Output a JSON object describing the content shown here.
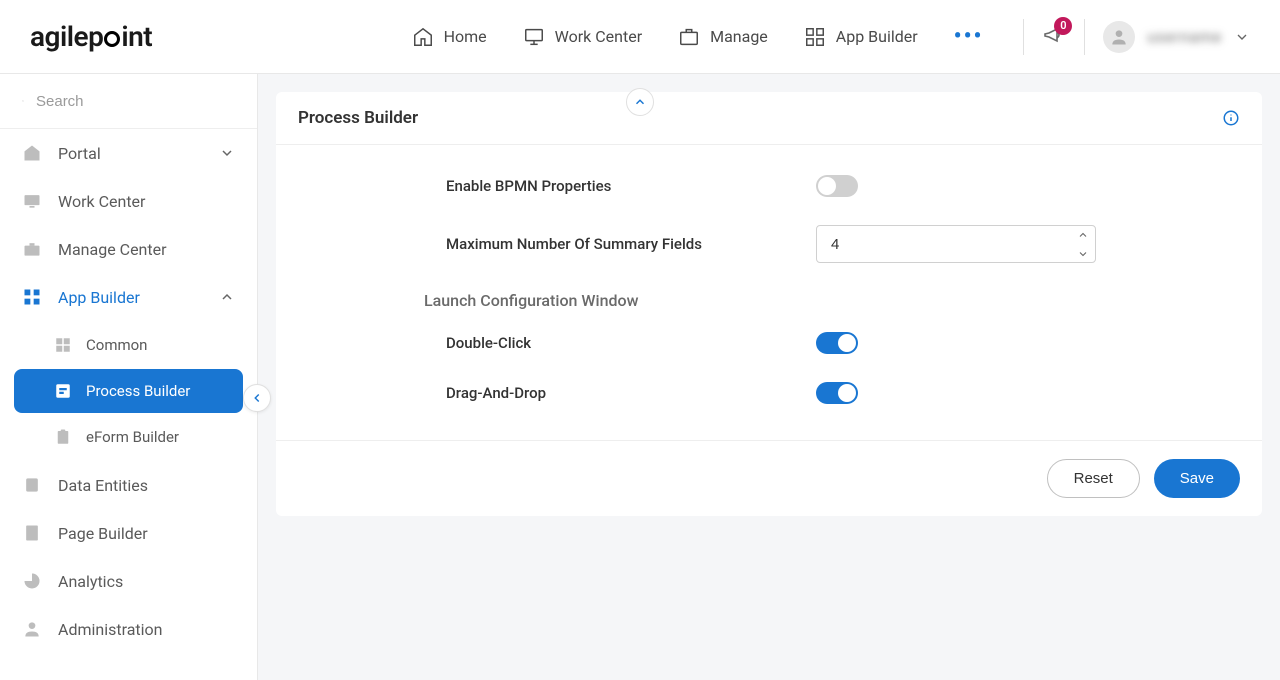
{
  "header": {
    "nav": {
      "home": "Home",
      "work_center": "Work Center",
      "manage": "Manage",
      "app_builder": "App Builder"
    },
    "notif_count": "0",
    "username": "username"
  },
  "search": {
    "placeholder": "Search"
  },
  "sidebar": {
    "portal": "Portal",
    "work_center": "Work Center",
    "manage_center": "Manage Center",
    "app_builder": "App Builder",
    "app_builder_sub": {
      "common": "Common",
      "process_builder": "Process Builder",
      "eform_builder": "eForm Builder"
    },
    "data_entities": "Data Entities",
    "page_builder": "Page Builder",
    "analytics": "Analytics",
    "administration": "Administration"
  },
  "panel": {
    "title": "Process Builder",
    "enable_bpmn_label": "Enable BPMN Properties",
    "max_summary_label": "Maximum Number Of Summary Fields",
    "max_summary_value": "4",
    "launch_section": "Launch Configuration Window",
    "double_click_label": "Double-Click",
    "drag_drop_label": "Drag-And-Drop",
    "reset": "Reset",
    "save": "Save"
  }
}
